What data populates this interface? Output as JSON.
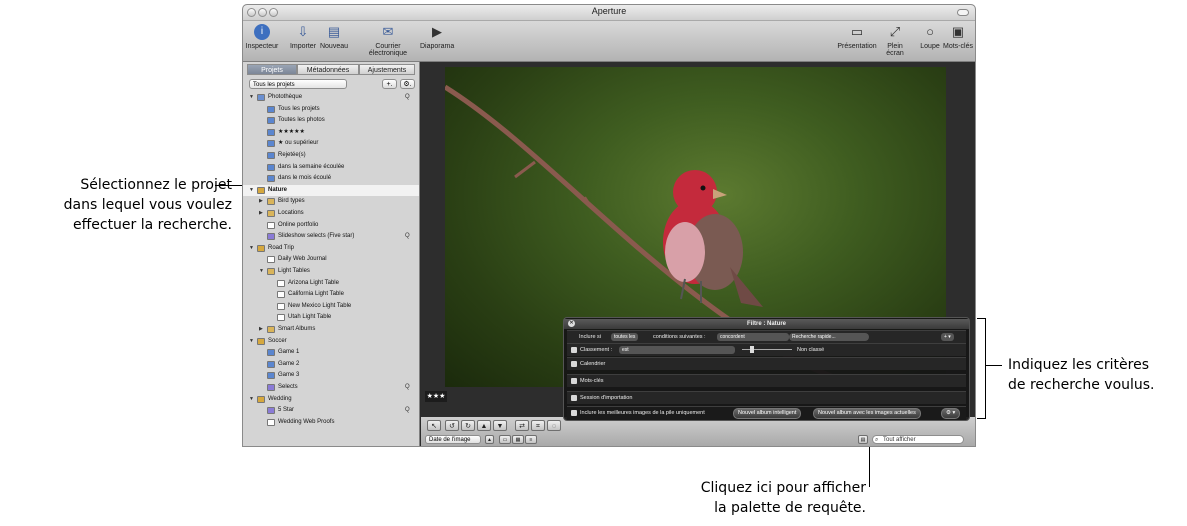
{
  "window": {
    "title": "Aperture"
  },
  "toolbar": {
    "left": [
      {
        "label": "Inspecteur",
        "icon": "info-icon"
      },
      {
        "label": "Importer",
        "icon": "import-icon"
      },
      {
        "label": "Nouveau",
        "icon": "new-icon"
      },
      {
        "label": "Courrier électronique",
        "icon": "mail-icon"
      },
      {
        "label": "Diaporama",
        "icon": "play-icon"
      }
    ],
    "right": [
      {
        "label": "Présentation",
        "icon": "presentation-icon"
      },
      {
        "label": "Plein écran",
        "icon": "fullscreen-icon"
      },
      {
        "label": "Loupe",
        "icon": "loupe-icon"
      },
      {
        "label": "Mots-clés",
        "icon": "keywords-icon"
      }
    ]
  },
  "sidebar": {
    "tabs": [
      "Projets",
      "Métadonnées",
      "Ajustements"
    ],
    "project_filter": "Tous les projets",
    "add_button": "+.",
    "action_button": "⚙.",
    "items": [
      {
        "label": "Photothèque",
        "level": 0,
        "triangle": "▼",
        "icon": "library",
        "action": "Q"
      },
      {
        "label": "Tous les projets",
        "level": 1,
        "icon": "album"
      },
      {
        "label": "Toutes les photos",
        "level": 1,
        "icon": "album"
      },
      {
        "label": "★★★★★",
        "level": 1,
        "icon": "album"
      },
      {
        "label": "★ ou supérieur",
        "level": 1,
        "icon": "album"
      },
      {
        "label": "Rejetée(s)",
        "level": 1,
        "icon": "album"
      },
      {
        "label": "dans la semaine écoulée",
        "level": 1,
        "icon": "album"
      },
      {
        "label": "dans le mois écoulé",
        "level": 1,
        "icon": "album"
      },
      {
        "label": "Nature",
        "level": 0,
        "triangle": "▼",
        "icon": "project",
        "selected": true
      },
      {
        "label": "Bird types",
        "level": 1,
        "triangle": "▶",
        "icon": "folder"
      },
      {
        "label": "Locations",
        "level": 1,
        "triangle": "▶",
        "icon": "folder"
      },
      {
        "label": "Online portfolio",
        "level": 1,
        "icon": "web"
      },
      {
        "label": "Slideshow selects (Five star)",
        "level": 1,
        "icon": "smart",
        "action": "Q"
      },
      {
        "label": "Road Trip",
        "level": 0,
        "triangle": "▼",
        "icon": "project"
      },
      {
        "label": "Daily Web Journal",
        "level": 1,
        "icon": "web"
      },
      {
        "label": "Light Tables",
        "level": 1,
        "triangle": "▼",
        "icon": "folder"
      },
      {
        "label": "Arizona Light Table",
        "level": 2,
        "icon": "lighttable"
      },
      {
        "label": "California Light Table",
        "level": 2,
        "icon": "lighttable"
      },
      {
        "label": "New Mexico Light Table",
        "level": 2,
        "icon": "lighttable"
      },
      {
        "label": "Utah Light Table",
        "level": 2,
        "icon": "lighttable"
      },
      {
        "label": "Smart Albums",
        "level": 1,
        "triangle": "▶",
        "icon": "folder"
      },
      {
        "label": "Soccer",
        "level": 0,
        "triangle": "▼",
        "icon": "project"
      },
      {
        "label": "Game 1",
        "level": 1,
        "icon": "album"
      },
      {
        "label": "Game 2",
        "level": 1,
        "icon": "album"
      },
      {
        "label": "Game 3",
        "level": 1,
        "icon": "album"
      },
      {
        "label": "Selects",
        "level": 1,
        "icon": "smart",
        "action": "Q"
      },
      {
        "label": "Wedding",
        "level": 0,
        "triangle": "▼",
        "icon": "project"
      },
      {
        "label": "5 Star",
        "level": 1,
        "icon": "smart",
        "action": "Q"
      },
      {
        "label": "Wedding Web Proofs",
        "level": 1,
        "icon": "web"
      }
    ]
  },
  "viewer": {
    "rating_badge": "★★★"
  },
  "bottombar": {
    "sort": "Date de l'image",
    "search_placeholder": "Tout afficher"
  },
  "filter_hud": {
    "title": "Filtre : Nature",
    "include_label": "Inclure si",
    "include_mode": "toutes les",
    "conditions_label": "conditions suivantes :",
    "match_mode": "concordent",
    "quick_search": "Recherche rapide...",
    "rating_label": "Classement :",
    "rating_op": "est",
    "rating_value": "Non classé",
    "calendar_label": "Calendrier",
    "keywords_label": "Mots-clés",
    "import_session_label": "Session d'importation",
    "stack_label": "Inclure les meilleures images de la pile uniquement",
    "new_smart_album": "Nouvel album intelligent",
    "new_album_current": "Nouvel album avec les images actuelles"
  },
  "callouts": {
    "select_project": [
      "Sélectionnez le projet",
      "dans lequel vous voulez",
      "effectuer la recherche."
    ],
    "criteria": [
      "Indiquez les critères",
      "de recherche voulus."
    ],
    "click_here": [
      "Cliquez ici pour afficher",
      "la palette de requête."
    ]
  },
  "colors": {
    "selection_highlight": "#f2f2f2",
    "bird_red": "#c42a3c",
    "branch": "#8a5a4e"
  }
}
